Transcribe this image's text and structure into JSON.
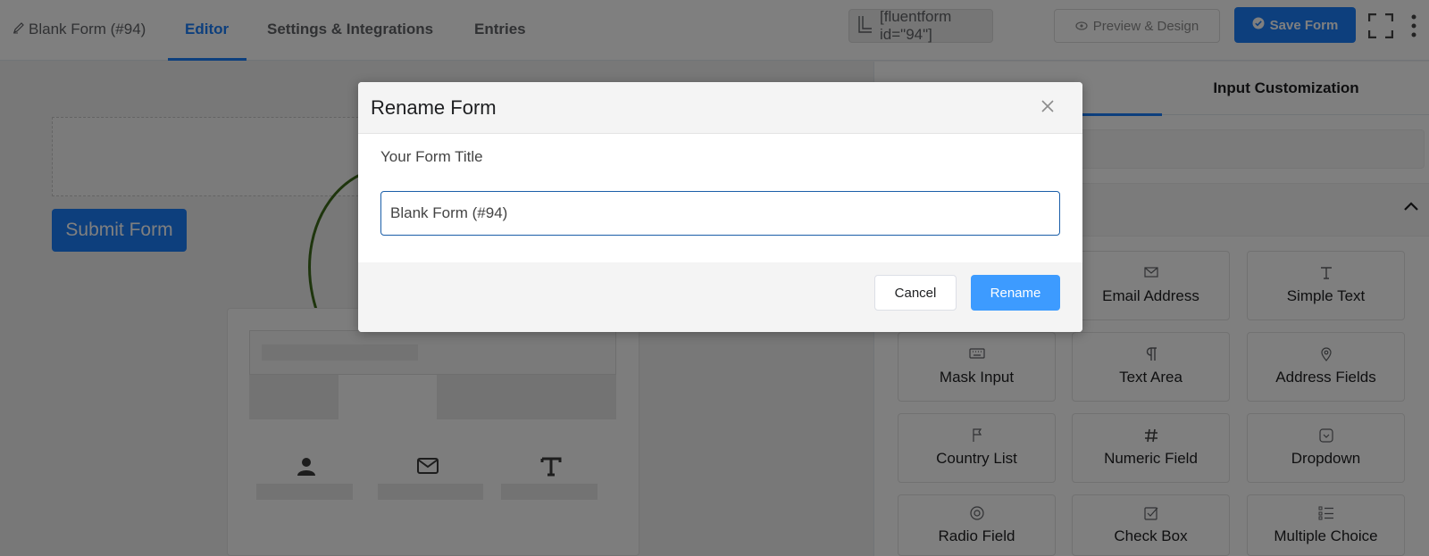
{
  "header": {
    "form_title": "Blank Form (#94)",
    "tabs": [
      {
        "label": "Editor",
        "active": true
      },
      {
        "label": "Settings & Integrations",
        "active": false
      },
      {
        "label": "Entries",
        "active": false
      }
    ],
    "shortcode": "[fluentform id=\"94\"]",
    "preview_label": "Preview & Design",
    "save_label": "Save Form"
  },
  "canvas": {
    "submit_label": "Submit Form"
  },
  "right_panel": {
    "tabs": [
      {
        "label": "Input Customization",
        "active": false
      }
    ],
    "fields": [
      {
        "label": "Email Address",
        "icon": "envelope-icon"
      },
      {
        "label": "Simple Text",
        "icon": "text-icon"
      },
      {
        "label": "Mask Input",
        "icon": "keyboard-icon"
      },
      {
        "label": "Text Area",
        "icon": "paragraph-icon"
      },
      {
        "label": "Address Fields",
        "icon": "map-pin-icon"
      },
      {
        "label": "Country List",
        "icon": "flag-icon"
      },
      {
        "label": "Numeric Field",
        "icon": "hash-icon"
      },
      {
        "label": "Dropdown",
        "icon": "dropdown-icon"
      },
      {
        "label": "Radio Field",
        "icon": "radio-icon"
      },
      {
        "label": "Check Box",
        "icon": "checkbox-icon"
      },
      {
        "label": "Multiple Choice",
        "icon": "list-icon"
      }
    ]
  },
  "modal": {
    "title": "Rename Form",
    "field_label": "Your Form Title",
    "input_value": "Blank Form (#94)",
    "cancel_label": "Cancel",
    "rename_label": "Rename"
  },
  "colors": {
    "primary": "#1a7efb",
    "rename_button": "#3d9bff",
    "overlay": "rgba(0,0,0,0.5)"
  }
}
